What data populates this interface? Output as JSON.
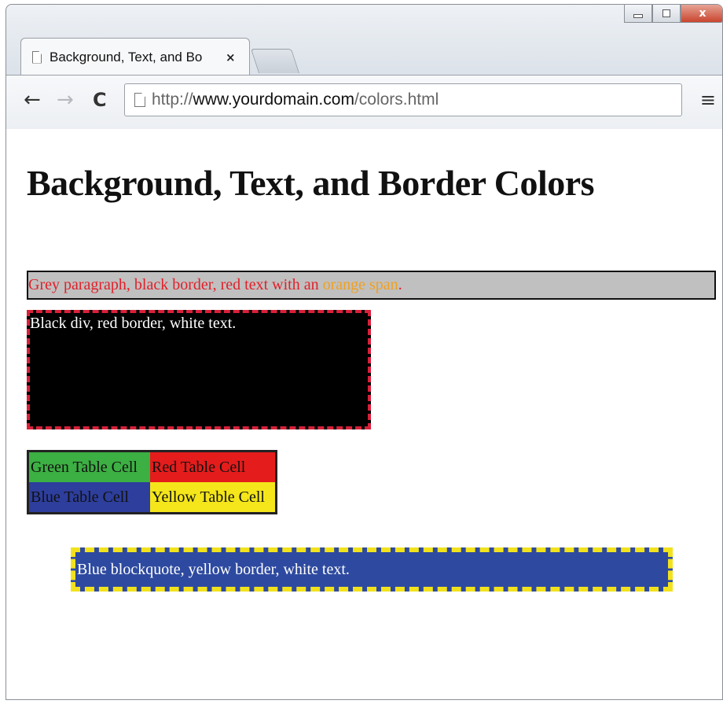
{
  "browser": {
    "tab": {
      "title": "Background, Text, and Bo",
      "close_glyph": "×"
    },
    "window_controls": {
      "close_glyph": "x"
    },
    "toolbar": {
      "back_glyph": "←",
      "forward_glyph": "→",
      "reload_glyph": "C",
      "url_scheme": "http://",
      "url_host": "www.yourdomain.com",
      "url_path": "/colors.html",
      "menu_glyph": "≡"
    }
  },
  "page": {
    "heading": "Background, Text, and Border Colors",
    "grey_paragraph": {
      "text_before": "Grey paragraph, black border, red text with an ",
      "span_text": "orange span",
      "text_after": "."
    },
    "black_div_text": "Black div, red border, white text.",
    "table": {
      "green_cell": "Green Table Cell",
      "red_cell": "Red Table Cell",
      "blue_cell": "Blue Table Cell",
      "yellow_cell": "Yellow Table Cell"
    },
    "blockquote_text": "Blue blockquote, yellow border, white text."
  },
  "colors": {
    "grey_bg": "#c0c0c0",
    "red_text": "#e0202a",
    "orange_span": "#f0a020",
    "green_cell": "#3cb043",
    "red_cell": "#e51c1c",
    "blue_cell": "#2d3e9c",
    "yellow_cell": "#f4e61a",
    "blockquote_bg": "#2e4aa0",
    "blockquote_border": "#f2e21d"
  },
  "icons": {
    "tab_page": "page-icon",
    "address_page": "page-icon",
    "menu": "hamburger-menu-icon"
  }
}
